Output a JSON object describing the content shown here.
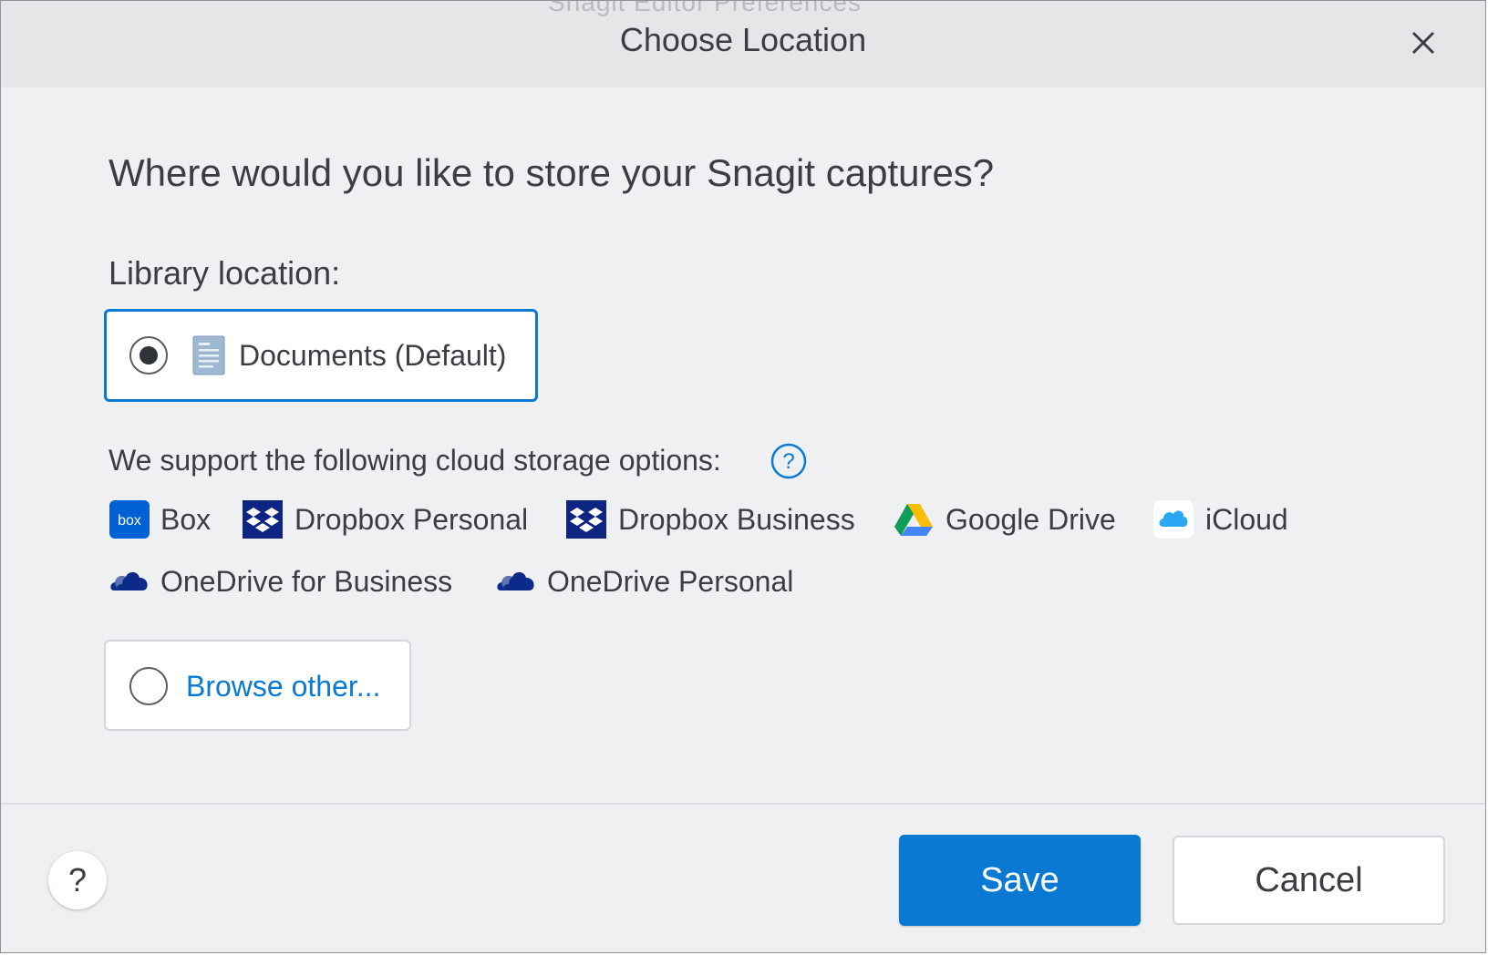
{
  "window": {
    "ghost_title": "Snagit Editor Preferences",
    "title": "Choose Location"
  },
  "main": {
    "question": "Where would you like to store your Snagit captures?",
    "library_label": "Library location:",
    "options": {
      "documents": {
        "label": "Documents (Default)",
        "selected": true,
        "icon": "document-icon"
      },
      "browse": {
        "label": "Browse other...",
        "selected": false
      }
    },
    "support_text": "We support the following cloud storage options:",
    "cloud_services": [
      {
        "label": "Box",
        "icon": "box-icon"
      },
      {
        "label": "Dropbox Personal",
        "icon": "dropbox-icon"
      },
      {
        "label": "Dropbox Business",
        "icon": "dropbox-icon"
      },
      {
        "label": "Google Drive",
        "icon": "google-drive-icon"
      },
      {
        "label": "iCloud",
        "icon": "icloud-icon"
      },
      {
        "label": "OneDrive for Business",
        "icon": "onedrive-icon"
      },
      {
        "label": "OneDrive Personal",
        "icon": "onedrive-icon"
      }
    ]
  },
  "footer": {
    "help_label": "?",
    "save_label": "Save",
    "cancel_label": "Cancel"
  },
  "colors": {
    "accent": "#0a79d4",
    "background": "#eff0f2",
    "titlebar": "#e5e6e8",
    "text": "#3a3d42",
    "box_brand": "#0061d5",
    "dropbox_brand": "#0d2481",
    "onedrive_brand": "#0c2a8a"
  }
}
